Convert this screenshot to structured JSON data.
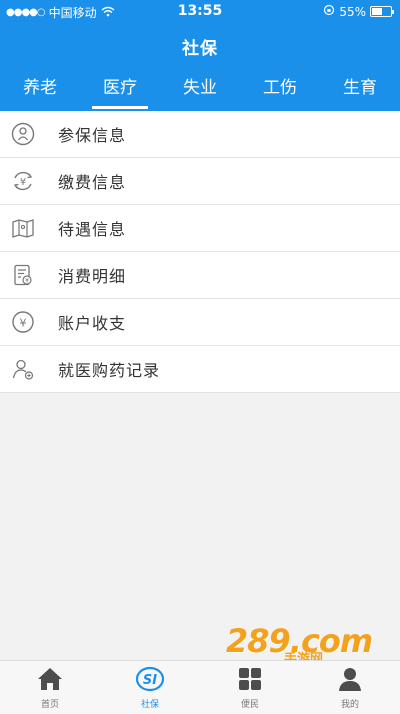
{
  "status_bar": {
    "signal_dots": "●●●●○",
    "carrier": "中国移动",
    "time": "13:55",
    "battery_text": "55%",
    "battery_level": 0.55
  },
  "header": {
    "title": "社保",
    "accent_color": "#1a90ea"
  },
  "tabs": [
    {
      "label": "养老",
      "active": false
    },
    {
      "label": "医疗",
      "active": true
    },
    {
      "label": "失业",
      "active": false
    },
    {
      "label": "工伤",
      "active": false
    },
    {
      "label": "生育",
      "active": false
    }
  ],
  "menu": [
    {
      "label": "参保信息",
      "icon": "person-badge-icon"
    },
    {
      "label": "缴费信息",
      "icon": "yuan-refresh-icon"
    },
    {
      "label": "待遇信息",
      "icon": "map-icon"
    },
    {
      "label": "消费明细",
      "icon": "document-icon"
    },
    {
      "label": "账户收支",
      "icon": "yuan-circle-icon"
    },
    {
      "label": "就医购药记录",
      "icon": "user-record-icon"
    }
  ],
  "bottom_nav": [
    {
      "label": "首页",
      "icon": "home-icon"
    },
    {
      "label": "社保",
      "icon": "social-security-icon"
    },
    {
      "label": "便民",
      "icon": "grid-icon"
    },
    {
      "label": "我的",
      "icon": "profile-icon"
    }
  ],
  "watermark": {
    "main": "289.com",
    "sub": "手游网"
  }
}
